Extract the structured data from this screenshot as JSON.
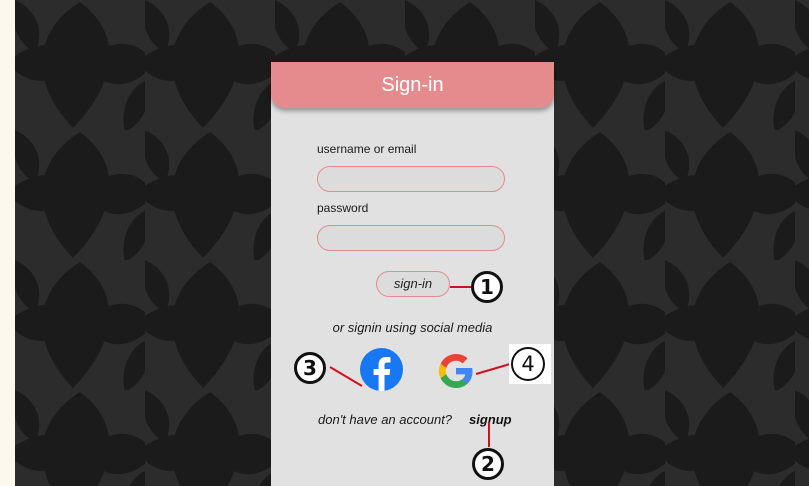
{
  "header": {
    "title": "Sign-in"
  },
  "form": {
    "username_label": "username or email",
    "username_value": "",
    "password_label": "password",
    "password_value": "",
    "signin_button": "sign-in"
  },
  "social": {
    "text": "or signin using social media",
    "icons": [
      "facebook-icon",
      "google-icon"
    ]
  },
  "signup": {
    "prompt": "don't have an account?",
    "link": "signup"
  },
  "annotations": {
    "sign_in": "1",
    "sign_up": "2",
    "facebook": "3",
    "google": "4"
  },
  "colors": {
    "accent": "#e58b8e",
    "card": "#e1e1e1",
    "background": "#2c2c2c",
    "callout_line": "#d0101a"
  }
}
